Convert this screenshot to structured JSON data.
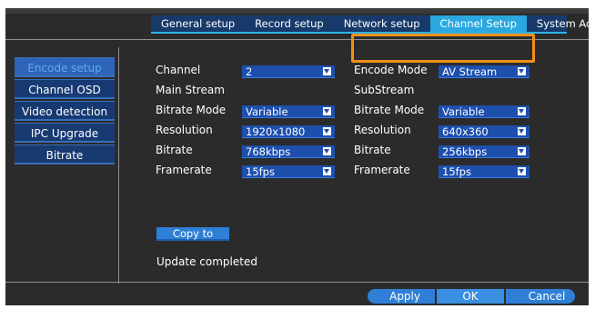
{
  "tabs": [
    {
      "label": "General setup"
    },
    {
      "label": "Record setup"
    },
    {
      "label": "Network setup"
    },
    {
      "label": "Channel Setup"
    },
    {
      "label": "System Admin"
    }
  ],
  "active_tab": "Channel Setup",
  "sidebar": {
    "items": [
      {
        "label": "Encode setup"
      },
      {
        "label": "Channel OSD"
      },
      {
        "label": "Video detection"
      },
      {
        "label": "IPC Upgrade"
      },
      {
        "label": "Bitrate"
      }
    ],
    "active": "Encode setup"
  },
  "form": {
    "channel_label": "Channel",
    "channel_value": "2",
    "encode_mode_label": "Encode Mode",
    "encode_mode_value": "AV Stream",
    "main_stream_title": "Main Stream",
    "sub_stream_title": "SubStream",
    "main": {
      "bitrate_mode_label": "Bitrate Mode",
      "bitrate_mode_value": "Variable",
      "resolution_label": "Resolution",
      "resolution_value": "1920x1080",
      "bitrate_label": "Bitrate",
      "bitrate_value": "768kbps",
      "framerate_label": "Framerate",
      "framerate_value": "15fps"
    },
    "sub": {
      "bitrate_mode_label": "Bitrate Mode",
      "bitrate_mode_value": "Variable",
      "resolution_label": "Resolution",
      "resolution_value": "640x360",
      "bitrate_label": "Bitrate",
      "bitrate_value": "256kbps",
      "framerate_label": "Framerate",
      "framerate_value": "15fps"
    }
  },
  "copy_label": "Copy to",
  "status_text": "Update completed",
  "buttons": {
    "apply": "Apply",
    "ok": "OK",
    "cancel": "Cancel"
  },
  "colors": {
    "background": "#2b2b2b",
    "tab_bar": "#183a6b",
    "tab_active": "#2aa8df",
    "select_bg": "#1d4fad",
    "highlight": "#f0901a",
    "button": "#2f7fd6"
  },
  "icons": {
    "dropdown": "chevron-down-icon"
  }
}
